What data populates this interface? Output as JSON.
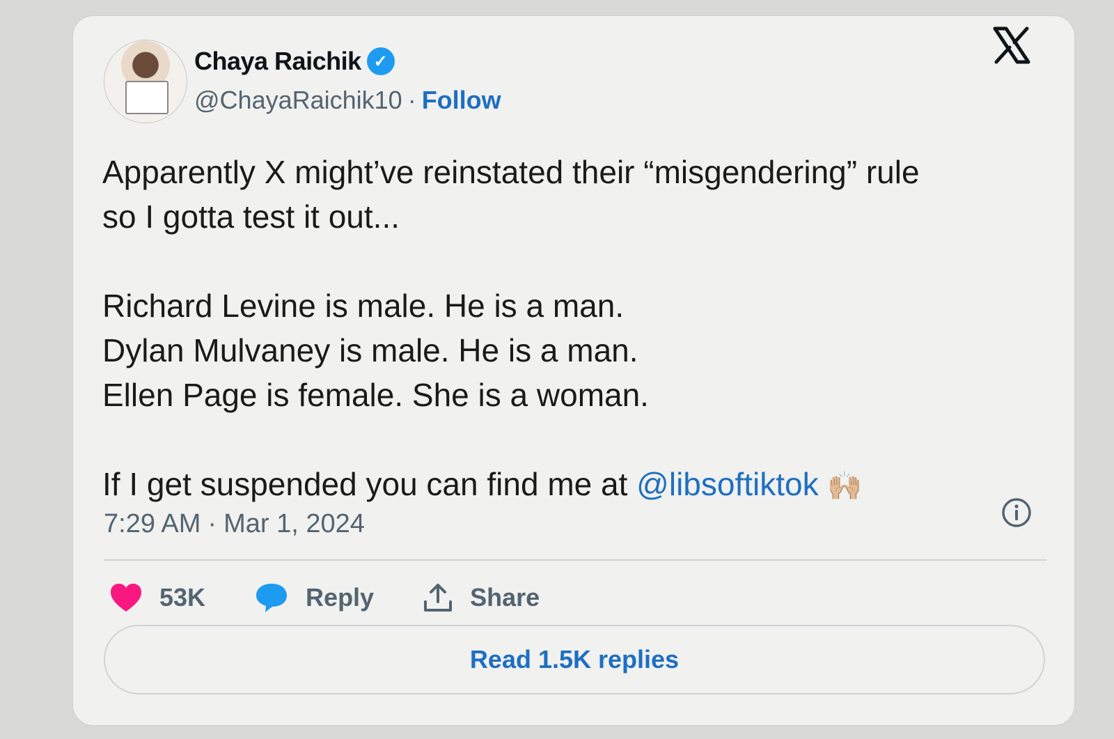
{
  "author": {
    "name": "Chaya Raichik",
    "handle": "@ChayaRaichik10",
    "separator": "·",
    "follow_label": "Follow"
  },
  "tweet": {
    "line1": "Apparently X might’ve reinstated their “misgendering” rule",
    "line2": "so I gotta test it out...",
    "line3": "Richard Levine is male. He is a man.",
    "line4": "Dylan Mulvaney is male. He is a man.",
    "line5": "Ellen Page is female. She is a woman.",
    "line6_prefix": "If I get suspended you can find me at ",
    "line6_mention": "@libsoftiktok",
    "line6_emoji": "🙌🏼"
  },
  "meta": {
    "time": "7:29 AM",
    "separator": "·",
    "date": "Mar 1, 2024"
  },
  "actions": {
    "likes": "53K",
    "reply_label": "Reply",
    "share_label": "Share"
  },
  "replies_button": "Read 1.5K replies",
  "colors": {
    "like": "#f91880",
    "reply": "#1d9bf0",
    "link": "#1d6fc2",
    "verified": "#1d9bf0"
  }
}
